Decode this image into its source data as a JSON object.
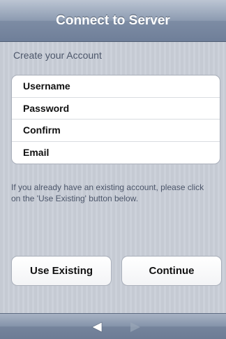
{
  "navbar": {
    "title": "Connect to Server"
  },
  "form": {
    "header": "Create your Account",
    "fields": [
      {
        "label": "Username"
      },
      {
        "label": "Password"
      },
      {
        "label": "Confirm"
      },
      {
        "label": "Email"
      }
    ]
  },
  "info_text": "If you already have an existing account, please click on the 'Use Existing' button below.",
  "buttons": {
    "use_existing": "Use Existing",
    "continue": "Continue"
  },
  "toolbar": {
    "back_icon": "back-arrow-icon",
    "forward_icon": "forward-arrow-icon",
    "forward_enabled": false
  }
}
